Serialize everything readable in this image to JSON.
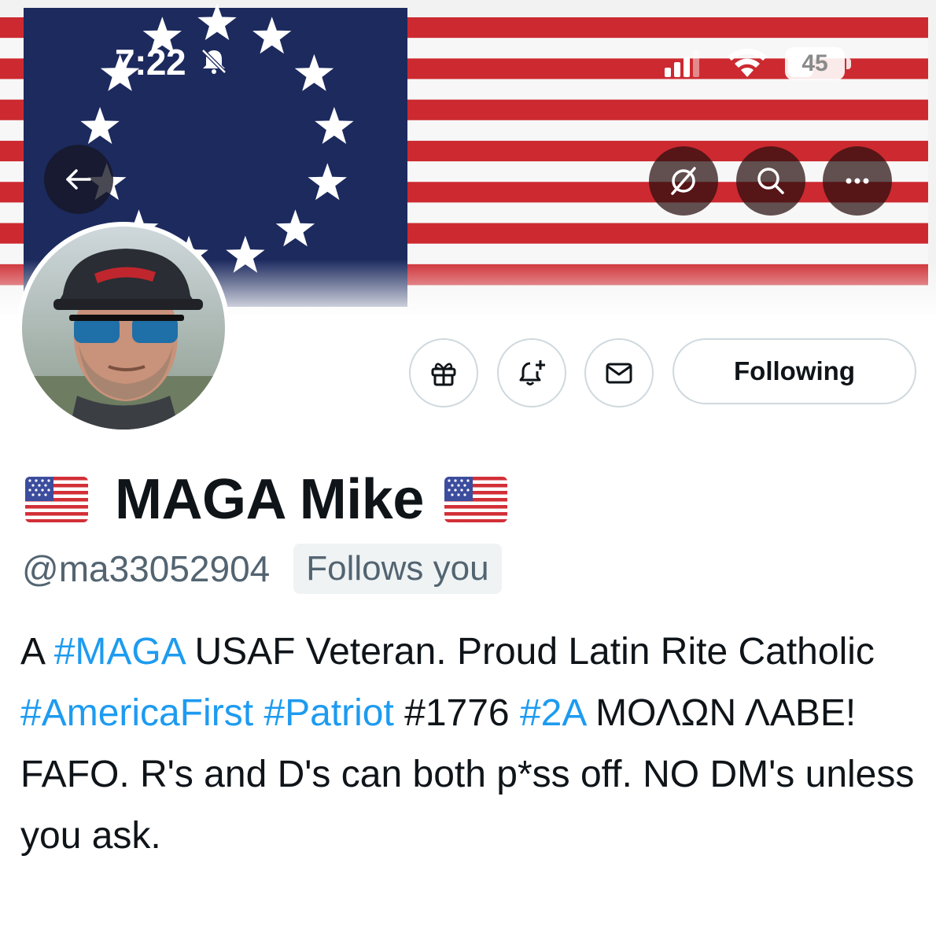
{
  "status_bar": {
    "time": "7:22",
    "battery": "45"
  },
  "banner": {
    "image": "betsy-ross-flag",
    "colors": {
      "stripe_red": "#cc2a30",
      "canton_blue": "#1c2a5e",
      "star_white": "#ffffff"
    }
  },
  "nav": {
    "back_icon": "arrow-left-icon",
    "grok_icon": "grok-slash-icon",
    "search_icon": "search-icon",
    "more_icon": "ellipsis-icon"
  },
  "actions": {
    "gift_icon": "gift-icon",
    "notify_icon": "bell-plus-icon",
    "message_icon": "envelope-icon",
    "following_label": "Following"
  },
  "profile": {
    "display_name": "MAGA Mike",
    "handle": "@ma33052904",
    "follows_you": "Follows you",
    "bio": {
      "p1": "A ",
      "tag_maga": "#MAGA",
      "p2": " USAF Veteran. Proud Latin Rite Catholic ",
      "tag_americafirst": "#AmericaFirst",
      "p3": " ",
      "tag_patriot": "#Patriot",
      "p4": " #1776 ",
      "tag_2a": "#2A",
      "p5": " ΜΟΛΩΝ ΛΑΒΕ! FAFO. R's and D's can both p*ss off. NO DM's unless you ask."
    }
  },
  "colors": {
    "link": "#1d9bf0",
    "text_primary": "#0f1419",
    "text_secondary": "#536471",
    "border": "#cfd9de"
  }
}
